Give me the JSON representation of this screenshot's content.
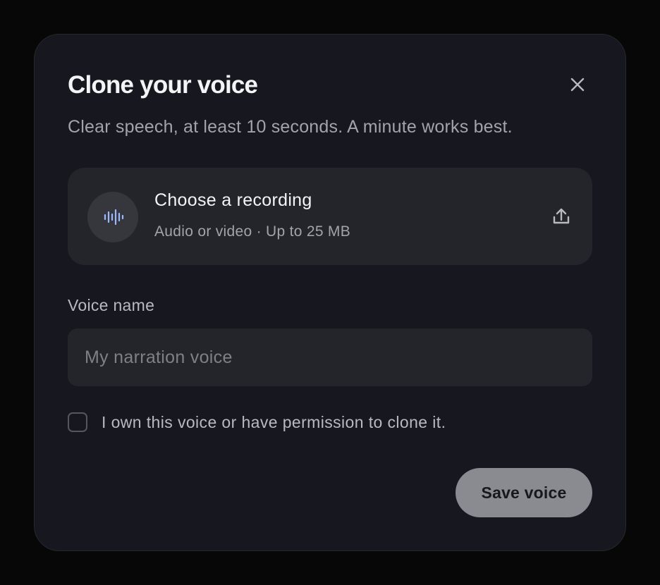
{
  "dialog": {
    "title": "Clone your voice",
    "subtitle": "Clear speech, at least 10 seconds. A minute works best.",
    "close_icon": "close-icon"
  },
  "upload": {
    "icon": "audio-wave-icon",
    "title": "Choose a recording",
    "meta": "Audio or video · Up to 25 MB",
    "action_icon": "upload-icon"
  },
  "voice_name": {
    "label": "Voice name",
    "value": "",
    "placeholder": "My narration voice"
  },
  "consent": {
    "checked": false,
    "label": "I own this voice or have permission to clone it."
  },
  "actions": {
    "save_label": "Save voice"
  },
  "colors": {
    "background": "#070707",
    "modal": "#17181f",
    "card": "#24252b",
    "accent_wave": "#9db7ff",
    "disabled_button": "#8a8b90"
  }
}
